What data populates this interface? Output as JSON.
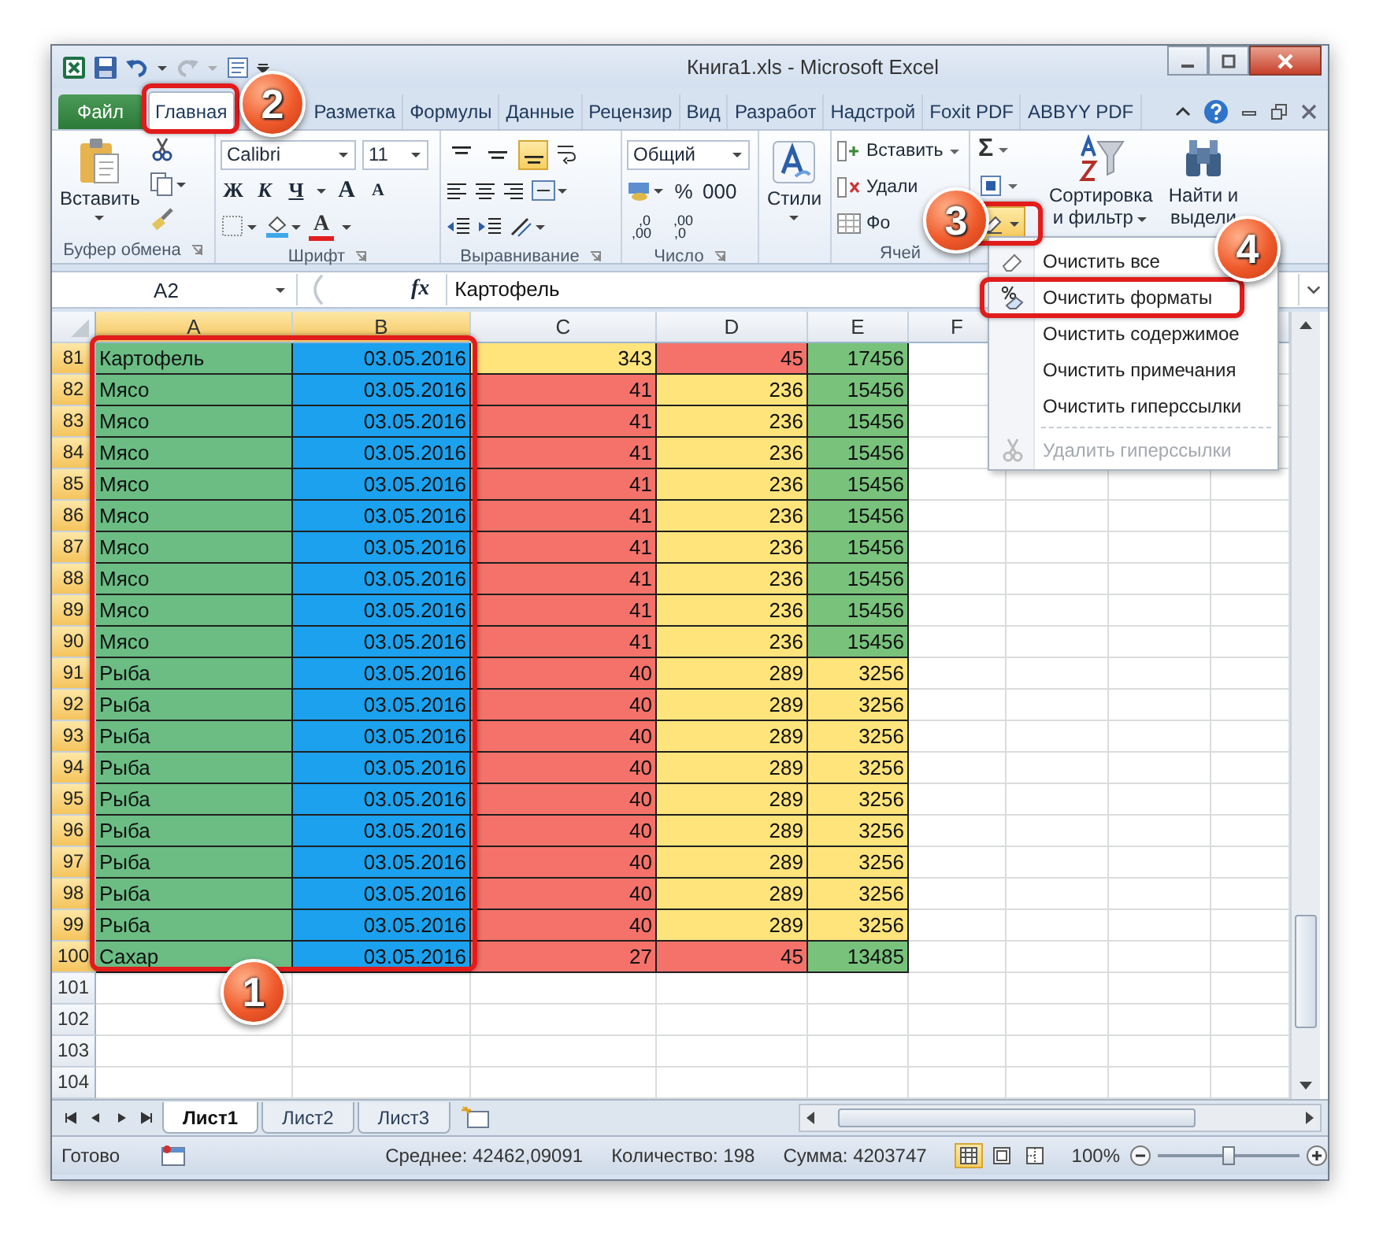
{
  "window": {
    "title": "Книга1.xls - Microsoft Excel"
  },
  "tabs": [
    {
      "label": "Файл",
      "kind": "file",
      "selected": false
    },
    {
      "label": "Главная",
      "kind": "tab",
      "selected": true
    },
    {
      "label": "Разметка",
      "kind": "tab",
      "selected": false
    },
    {
      "label": "Формулы",
      "kind": "tab",
      "selected": false
    },
    {
      "label": "Данные",
      "kind": "tab",
      "selected": false
    },
    {
      "label": "Рецензир",
      "kind": "tab",
      "selected": false
    },
    {
      "label": "Вид",
      "kind": "tab",
      "selected": false
    },
    {
      "label": "Разработ",
      "kind": "tab",
      "selected": false
    },
    {
      "label": "Надстрой",
      "kind": "tab",
      "selected": false
    },
    {
      "label": "Foxit PDF",
      "kind": "tab",
      "selected": false
    },
    {
      "label": "ABBYY PDF",
      "kind": "tab",
      "selected": false
    }
  ],
  "ribbon": {
    "clipboard": {
      "paste": "Вставить",
      "label": "Буфер обмена"
    },
    "font": {
      "name": "Calibri",
      "size": "11",
      "bold": "Ж",
      "italic": "К",
      "underline": "Ч",
      "grow": "A",
      "shrink": "A",
      "color_letter": "A",
      "label": "Шрифт"
    },
    "alignment": {
      "vertical": [
        {
          "selected": false
        },
        {
          "selected": false
        },
        {
          "selected": true
        }
      ],
      "label": "Выравнивание"
    },
    "number": {
      "format": "Общий",
      "percent": "%",
      "thousands": "000",
      "decimals": [
        {
          "top": ",0",
          "bottom": ",00"
        },
        {
          "top": ",00",
          "bottom": ",0"
        }
      ],
      "label": "Число"
    },
    "styles": {
      "label": "Стили"
    },
    "cells": {
      "insert": "Вставить",
      "delete": "Удали",
      "format": "Фо",
      "label": "Ячей"
    },
    "editing": {
      "sum": "Σ",
      "clear_highlighted": true,
      "sort": [
        "Сортировка",
        "и фильтр"
      ],
      "find": [
        "Найти и",
        "выдели"
      ]
    }
  },
  "formula_bar": {
    "name_box": "A2",
    "fx": "fx",
    "value": "Картофель"
  },
  "columns": [
    {
      "label": "A",
      "selected": true
    },
    {
      "label": "B",
      "selected": true
    },
    {
      "label": "C",
      "selected": false
    },
    {
      "label": "D",
      "selected": false
    },
    {
      "label": "E",
      "selected": false
    },
    {
      "label": "F",
      "selected": false
    }
  ],
  "rows": [
    {
      "number": "81",
      "selected": true,
      "cells": [
        {
          "text": "Картофель",
          "color": "#6bbd84"
        },
        {
          "text": "03.05.2016",
          "color": "#1ba1ee"
        },
        {
          "text": "343",
          "color": "#ffe47c"
        },
        {
          "text": "45",
          "color": "#f4726a"
        },
        {
          "text": "17456",
          "color": "#78c27c"
        }
      ]
    },
    {
      "number": "82",
      "selected": true,
      "cells": [
        {
          "text": "Мясо",
          "color": "#6bbd84"
        },
        {
          "text": "03.05.2016",
          "color": "#1ba1ee"
        },
        {
          "text": "41",
          "color": "#f4726a"
        },
        {
          "text": "236",
          "color": "#ffe47c"
        },
        {
          "text": "15456",
          "color": "#78c27c"
        }
      ]
    },
    {
      "number": "83",
      "selected": true,
      "cells": [
        {
          "text": "Мясо",
          "color": "#6bbd84"
        },
        {
          "text": "03.05.2016",
          "color": "#1ba1ee"
        },
        {
          "text": "41",
          "color": "#f4726a"
        },
        {
          "text": "236",
          "color": "#ffe47c"
        },
        {
          "text": "15456",
          "color": "#78c27c"
        }
      ]
    },
    {
      "number": "84",
      "selected": true,
      "cells": [
        {
          "text": "Мясо",
          "color": "#6bbd84"
        },
        {
          "text": "03.05.2016",
          "color": "#1ba1ee"
        },
        {
          "text": "41",
          "color": "#f4726a"
        },
        {
          "text": "236",
          "color": "#ffe47c"
        },
        {
          "text": "15456",
          "color": "#78c27c"
        }
      ]
    },
    {
      "number": "85",
      "selected": true,
      "cells": [
        {
          "text": "Мясо",
          "color": "#6bbd84"
        },
        {
          "text": "03.05.2016",
          "color": "#1ba1ee"
        },
        {
          "text": "41",
          "color": "#f4726a"
        },
        {
          "text": "236",
          "color": "#ffe47c"
        },
        {
          "text": "15456",
          "color": "#78c27c"
        }
      ]
    },
    {
      "number": "86",
      "selected": true,
      "cells": [
        {
          "text": "Мясо",
          "color": "#6bbd84"
        },
        {
          "text": "03.05.2016",
          "color": "#1ba1ee"
        },
        {
          "text": "41",
          "color": "#f4726a"
        },
        {
          "text": "236",
          "color": "#ffe47c"
        },
        {
          "text": "15456",
          "color": "#78c27c"
        }
      ]
    },
    {
      "number": "87",
      "selected": true,
      "cells": [
        {
          "text": "Мясо",
          "color": "#6bbd84"
        },
        {
          "text": "03.05.2016",
          "color": "#1ba1ee"
        },
        {
          "text": "41",
          "color": "#f4726a"
        },
        {
          "text": "236",
          "color": "#ffe47c"
        },
        {
          "text": "15456",
          "color": "#78c27c"
        }
      ]
    },
    {
      "number": "88",
      "selected": true,
      "cells": [
        {
          "text": "Мясо",
          "color": "#6bbd84"
        },
        {
          "text": "03.05.2016",
          "color": "#1ba1ee"
        },
        {
          "text": "41",
          "color": "#f4726a"
        },
        {
          "text": "236",
          "color": "#ffe47c"
        },
        {
          "text": "15456",
          "color": "#78c27c"
        }
      ]
    },
    {
      "number": "89",
      "selected": true,
      "cells": [
        {
          "text": "Мясо",
          "color": "#6bbd84"
        },
        {
          "text": "03.05.2016",
          "color": "#1ba1ee"
        },
        {
          "text": "41",
          "color": "#f4726a"
        },
        {
          "text": "236",
          "color": "#ffe47c"
        },
        {
          "text": "15456",
          "color": "#78c27c"
        }
      ]
    },
    {
      "number": "90",
      "selected": true,
      "cells": [
        {
          "text": "Мясо",
          "color": "#6bbd84"
        },
        {
          "text": "03.05.2016",
          "color": "#1ba1ee"
        },
        {
          "text": "41",
          "color": "#f4726a"
        },
        {
          "text": "236",
          "color": "#ffe47c"
        },
        {
          "text": "15456",
          "color": "#78c27c"
        }
      ]
    },
    {
      "number": "91",
      "selected": true,
      "cells": [
        {
          "text": "Рыба",
          "color": "#6bbd84"
        },
        {
          "text": "03.05.2016",
          "color": "#1ba1ee"
        },
        {
          "text": "40",
          "color": "#f4726a"
        },
        {
          "text": "289",
          "color": "#ffe47c"
        },
        {
          "text": "3256",
          "color": "#ffe47c"
        }
      ]
    },
    {
      "number": "92",
      "selected": true,
      "cells": [
        {
          "text": "Рыба",
          "color": "#6bbd84"
        },
        {
          "text": "03.05.2016",
          "color": "#1ba1ee"
        },
        {
          "text": "40",
          "color": "#f4726a"
        },
        {
          "text": "289",
          "color": "#ffe47c"
        },
        {
          "text": "3256",
          "color": "#ffe47c"
        }
      ]
    },
    {
      "number": "93",
      "selected": true,
      "cells": [
        {
          "text": "Рыба",
          "color": "#6bbd84"
        },
        {
          "text": "03.05.2016",
          "color": "#1ba1ee"
        },
        {
          "text": "40",
          "color": "#f4726a"
        },
        {
          "text": "289",
          "color": "#ffe47c"
        },
        {
          "text": "3256",
          "color": "#ffe47c"
        }
      ]
    },
    {
      "number": "94",
      "selected": true,
      "cells": [
        {
          "text": "Рыба",
          "color": "#6bbd84"
        },
        {
          "text": "03.05.2016",
          "color": "#1ba1ee"
        },
        {
          "text": "40",
          "color": "#f4726a"
        },
        {
          "text": "289",
          "color": "#ffe47c"
        },
        {
          "text": "3256",
          "color": "#ffe47c"
        }
      ]
    },
    {
      "number": "95",
      "selected": true,
      "cells": [
        {
          "text": "Рыба",
          "color": "#6bbd84"
        },
        {
          "text": "03.05.2016",
          "color": "#1ba1ee"
        },
        {
          "text": "40",
          "color": "#f4726a"
        },
        {
          "text": "289",
          "color": "#ffe47c"
        },
        {
          "text": "3256",
          "color": "#ffe47c"
        }
      ]
    },
    {
      "number": "96",
      "selected": true,
      "cells": [
        {
          "text": "Рыба",
          "color": "#6bbd84"
        },
        {
          "text": "03.05.2016",
          "color": "#1ba1ee"
        },
        {
          "text": "40",
          "color": "#f4726a"
        },
        {
          "text": "289",
          "color": "#ffe47c"
        },
        {
          "text": "3256",
          "color": "#ffe47c"
        }
      ]
    },
    {
      "number": "97",
      "selected": true,
      "cells": [
        {
          "text": "Рыба",
          "color": "#6bbd84"
        },
        {
          "text": "03.05.2016",
          "color": "#1ba1ee"
        },
        {
          "text": "40",
          "color": "#f4726a"
        },
        {
          "text": "289",
          "color": "#ffe47c"
        },
        {
          "text": "3256",
          "color": "#ffe47c"
        }
      ]
    },
    {
      "number": "98",
      "selected": true,
      "cells": [
        {
          "text": "Рыба",
          "color": "#6bbd84"
        },
        {
          "text": "03.05.2016",
          "color": "#1ba1ee"
        },
        {
          "text": "40",
          "color": "#f4726a"
        },
        {
          "text": "289",
          "color": "#ffe47c"
        },
        {
          "text": "3256",
          "color": "#ffe47c"
        }
      ]
    },
    {
      "number": "99",
      "selected": true,
      "cells": [
        {
          "text": "Рыба",
          "color": "#6bbd84"
        },
        {
          "text": "03.05.2016",
          "color": "#1ba1ee"
        },
        {
          "text": "40",
          "color": "#f4726a"
        },
        {
          "text": "289",
          "color": "#ffe47c"
        },
        {
          "text": "3256",
          "color": "#ffe47c"
        }
      ]
    },
    {
      "number": "100",
      "selected": true,
      "cells": [
        {
          "text": "Сахар",
          "color": "#6bbd84"
        },
        {
          "text": "03.05.2016",
          "color": "#1ba1ee"
        },
        {
          "text": "27",
          "color": "#f4726a"
        },
        {
          "text": "45",
          "color": "#f4726a"
        },
        {
          "text": "13485",
          "color": "#78c27c"
        }
      ]
    },
    {
      "number": "101",
      "selected": false,
      "cells": []
    },
    {
      "number": "102",
      "selected": false,
      "cells": []
    },
    {
      "number": "103",
      "selected": false,
      "cells": []
    },
    {
      "number": "104",
      "selected": false,
      "cells": []
    }
  ],
  "clear_menu": [
    {
      "kind": "item",
      "label": "Очистить все",
      "disabled": false
    },
    {
      "kind": "item",
      "label": "Очистить форматы",
      "disabled": false
    },
    {
      "kind": "item",
      "label": "Очистить содержимое",
      "disabled": false
    },
    {
      "kind": "item",
      "label": "Очистить примечания",
      "disabled": false
    },
    {
      "kind": "item",
      "label": "Очистить гиперссылки",
      "disabled": false
    },
    {
      "kind": "separator"
    },
    {
      "kind": "item",
      "label": "Удалить гиперссылки",
      "disabled": true
    }
  ],
  "sheet_tabs": [
    {
      "label": "Лист1",
      "selected": true
    },
    {
      "label": "Лист2",
      "selected": false
    },
    {
      "label": "Лист3",
      "selected": false
    }
  ],
  "status_bar": {
    "ready": "Готово",
    "average": "Среднее: 42462,09091",
    "count": "Количество: 198",
    "sum": "Сумма: 4203747",
    "views": [
      {
        "selected": true
      },
      {
        "selected": false
      },
      {
        "selected": false
      }
    ],
    "zoom": "100%",
    "zoom_level": {
      "level": 0.5
    }
  },
  "callouts": [
    {
      "label": "1"
    },
    {
      "label": "2"
    },
    {
      "label": "3"
    },
    {
      "label": "4"
    }
  ]
}
